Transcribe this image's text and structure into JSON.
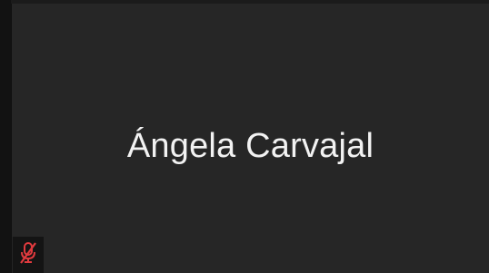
{
  "participant": {
    "name": "Ángela Carvajal",
    "mic_status_icon": "mic-muted-icon",
    "mic_muted": true
  },
  "colors": {
    "tile_background": "#262626",
    "name_text": "#f2f2f2",
    "muted_indicator": "#e03a3e"
  }
}
